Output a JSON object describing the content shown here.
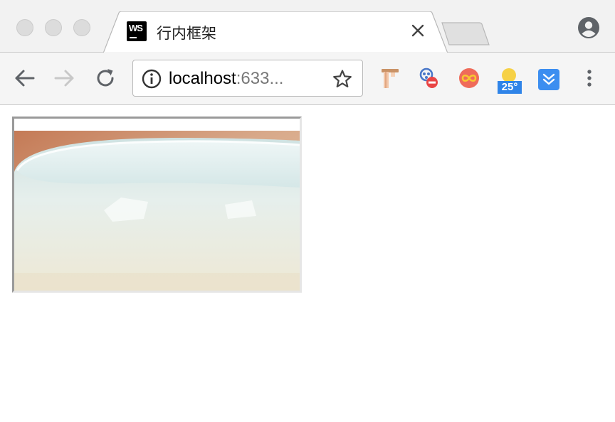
{
  "browser": {
    "tab": {
      "title": "行内框架",
      "favicon_text": "WS",
      "favicon_icon": "webstorm-icon"
    },
    "address_bar": {
      "host": "localhost",
      "port_truncated": ":633..."
    },
    "extensions": {
      "weather_temp": "25°"
    }
  },
  "page": {
    "iframe": {
      "content": "bowl-photo"
    }
  },
  "colors": {
    "tabstrip": "#f2f2f2",
    "toolbar": "#f5f5f5",
    "weather_badge": "#2f84e8",
    "iframe_border": "#9a9a9a"
  }
}
